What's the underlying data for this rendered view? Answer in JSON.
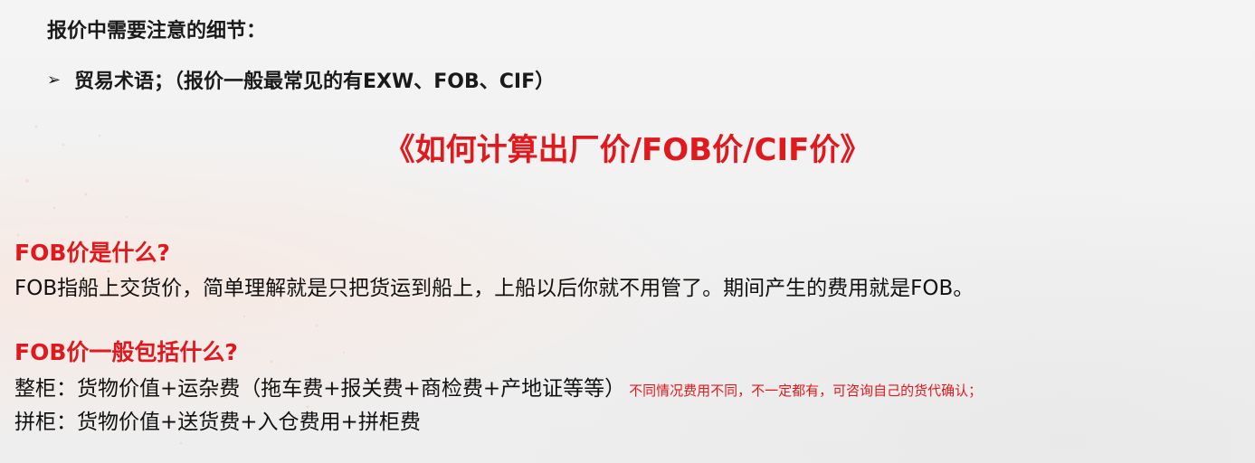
{
  "heading": "报价中需要注意的细节：",
  "bullet": {
    "marker": "➢",
    "text": "贸易术语；（报价一般最常见的有EXW、FOB、CIF）"
  },
  "center_title": "《如何计算出厂价/FOB价/CIF价》",
  "section1": {
    "question": "FOB价是什么?",
    "answer": "FOB指船上交货价，简单理解就是只把货运到船上，上船以后你就不用管了。期间产生的费用就是FOB。"
  },
  "section2": {
    "question": "FOB价一般包括什么?",
    "line1": "整柜：货物价值+运杂费（拖车费+报关费+商检费+产地证等等）",
    "note": "不同情况费用不同，不一定都有，可咨询自己的货代确认；",
    "line2": "拼柜：货物价值+送货费+入仓费用+拼柜费"
  },
  "colors": {
    "accent": "#e0191e",
    "text": "#111111",
    "background": "#f1f1f1"
  }
}
